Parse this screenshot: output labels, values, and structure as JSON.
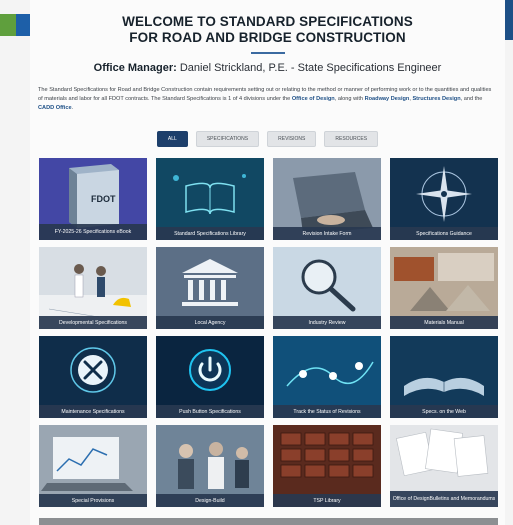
{
  "header": {
    "title_line1": "WELCOME TO STANDARD SPECIFICATIONS",
    "title_line2": "FOR ROAD AND BRIDGE CONSTRUCTION"
  },
  "manager": {
    "label": "Office Manager:",
    "name": "Daniel Strickland, P.E. - State Specifications Engineer"
  },
  "intro": {
    "text_start": "The Standard Specifications for Road and Bridge Construction contain requirements setting out or relating to the method or manner of performing work or to the quantities and qualities of materials and labor for all FDOT contracts. The Standard Specifications is 1 of 4 divisions under the ",
    "link_office_of_design": "Office of Design",
    "text_along": ", along with ",
    "link_roadway": "Roadway Design",
    "text_comma": ", ",
    "link_structures": "Structures Design",
    "text_and": ", and the ",
    "link_cadd": "CADD Office",
    "text_end": "."
  },
  "filters": [
    "ALL",
    "SPECIFICATIONS",
    "REVISIONS",
    "RESOURCES"
  ],
  "tiles": {
    "t1": "FY-2025-26 Specifications eBook",
    "t2": "Standard Specifications Library",
    "t3": "Revision Intake Form",
    "t4": "Specifications Guidance",
    "t5": "Developmental Specifications",
    "t6": "Local Agency",
    "t7": "Industry Review",
    "t8": "Materials Manual",
    "t9": "Maintenance Specifications",
    "t10": "Push Button Specifications",
    "t11": "Track the Status of Revisions",
    "t12": "Specs. on the Web",
    "t13": "Special Provisions",
    "t14": "Design-Build",
    "t15": "TSP Library",
    "t16a": "Office of Design",
    "t16b": "Bulletins and Memorandums"
  },
  "book_label": "FDOT",
  "colors": {
    "caption_bg": "#283850",
    "filter_active": "#1d3f6b",
    "link": "#1d4f86"
  }
}
